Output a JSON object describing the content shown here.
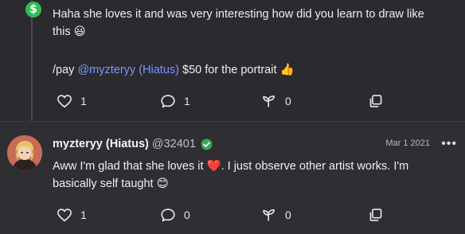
{
  "post_top": {
    "message_line1": "Haha she loves it and was very interesting how did you learn to draw like",
    "message_line2": "this",
    "emoji_grin": "😃",
    "pay_prefix": "/pay",
    "pay_mention": "@myzteryy (Hiatus)",
    "pay_suffix": "$50 for the portrait",
    "emoji_thumbs": "👍",
    "likes": "1",
    "comments": "1",
    "reposts": "0"
  },
  "post_bottom": {
    "author_name": "myzteryy (Hiatus)",
    "author_handle": "@32401",
    "date": "Mar 1 2021",
    "more_label": "•••",
    "message_line1_a": "Aww I'm glad that she loves it",
    "emoji_heart": "❤️",
    "message_line1_b": ". I just observe other artist works. I'm",
    "message_line2": "basically self taught",
    "emoji_smile": "😊",
    "likes": "1",
    "comments": "0",
    "reposts": "0"
  },
  "colors": {
    "background": "#2a2a2f",
    "mention": "#7f95ff",
    "cash_green": "#2fbe57",
    "verified_green": "#3ea85a",
    "heart_red": "#e0282e"
  },
  "icons": [
    "cash-app-icon",
    "heart-icon",
    "comment-icon",
    "sprout-icon",
    "copy-icon",
    "verified-icon",
    "more-icon"
  ]
}
